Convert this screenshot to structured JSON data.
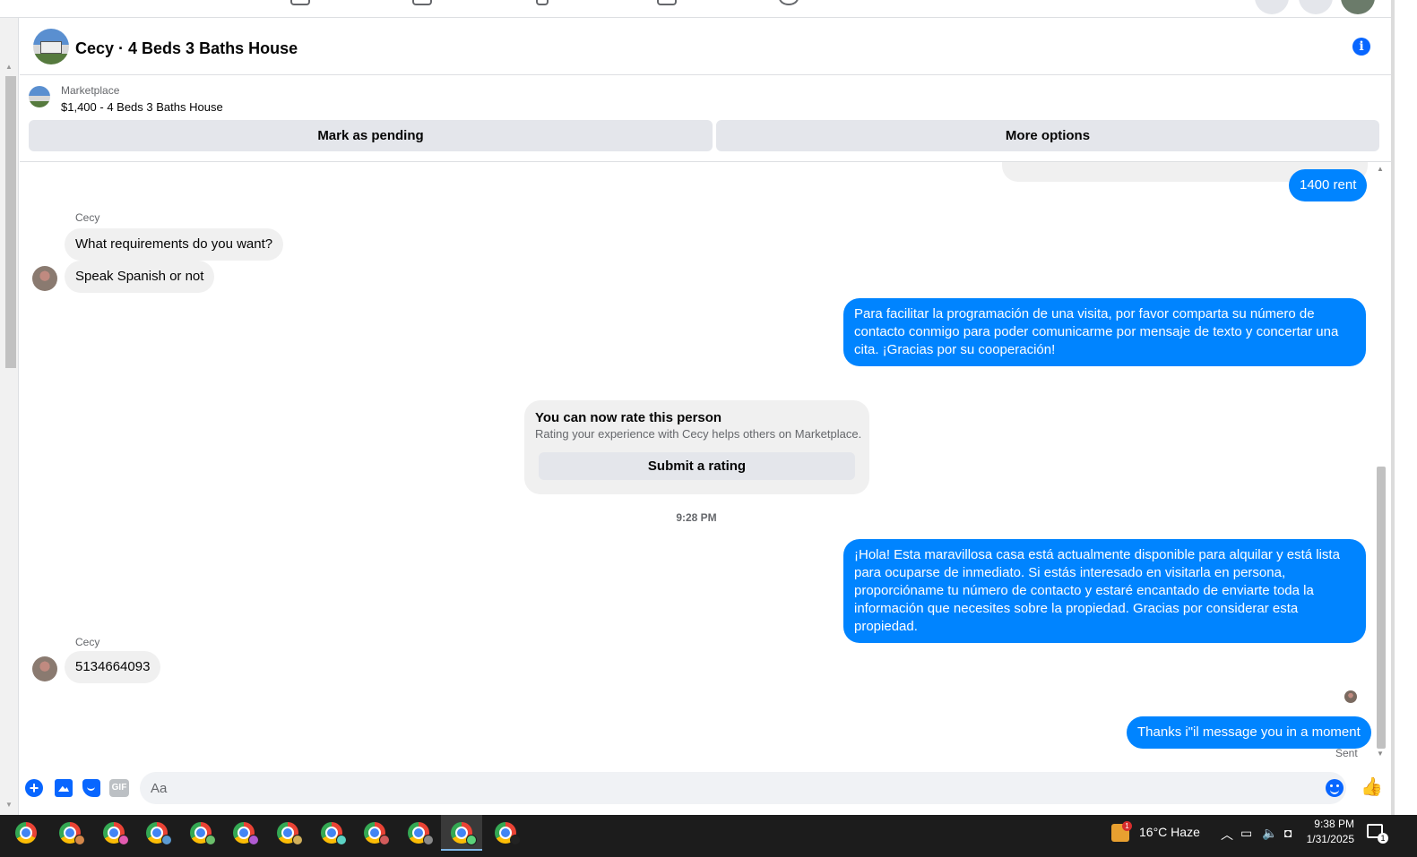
{
  "header": {
    "title": "Cecy · 4 Beds 3 Baths House"
  },
  "marketplace": {
    "label": "Marketplace",
    "item": "$1,400 - 4 Beds 3 Baths House",
    "mark_pending": "Mark as pending",
    "more_options": "More options"
  },
  "thread": {
    "msg_rent": "1400 rent",
    "sender_1": "Cecy",
    "msg_requirements": "What requirements do you want?",
    "msg_spanish": "Speak Spanish or not",
    "msg_contact": "Para facilitar la programación de una visita, por favor comparta su número de contacto conmigo para poder comunicarme por mensaje de texto y concertar una cita. ¡Gracias por su cooperación!",
    "rate_title": "You can now rate this person",
    "rate_subtitle": "Rating your experience with Cecy helps others on Marketplace.",
    "rate_button": "Submit a rating",
    "timestamp": "9:28 PM",
    "msg_hola": "¡Hola! Esta maravillosa casa está actualmente disponible para alquilar y está lista para ocuparse de inmediato. Si estás interesado en visitarla en persona, proporcióname tu número de contacto y estaré encantado de enviarte toda la información que necesites sobre la propiedad. Gracias por considerar esta propiedad.",
    "sender_2": "Cecy",
    "msg_phone": "5134664093",
    "msg_thanks": "Thanks i\"il message you in a moment",
    "sent_status": "Sent"
  },
  "composer": {
    "placeholder": "Aa",
    "gif_label": "GIF"
  },
  "taskbar": {
    "weather_badge": "1",
    "weather": "16°C  Haze",
    "time": "9:38 PM",
    "date": "1/31/2025",
    "notification_count": "1"
  },
  "colors": {
    "accent": "#0866ff",
    "outgoing_bubble": "#0084ff",
    "incoming_bubble": "#f0f0f0"
  },
  "icons": [
    "info-icon",
    "plus-icon",
    "photo-icon",
    "sticker-icon",
    "gif-icon",
    "emoji-icon",
    "thumbs-up-icon",
    "chrome-icon",
    "weather-icon",
    "notification-icon"
  ]
}
